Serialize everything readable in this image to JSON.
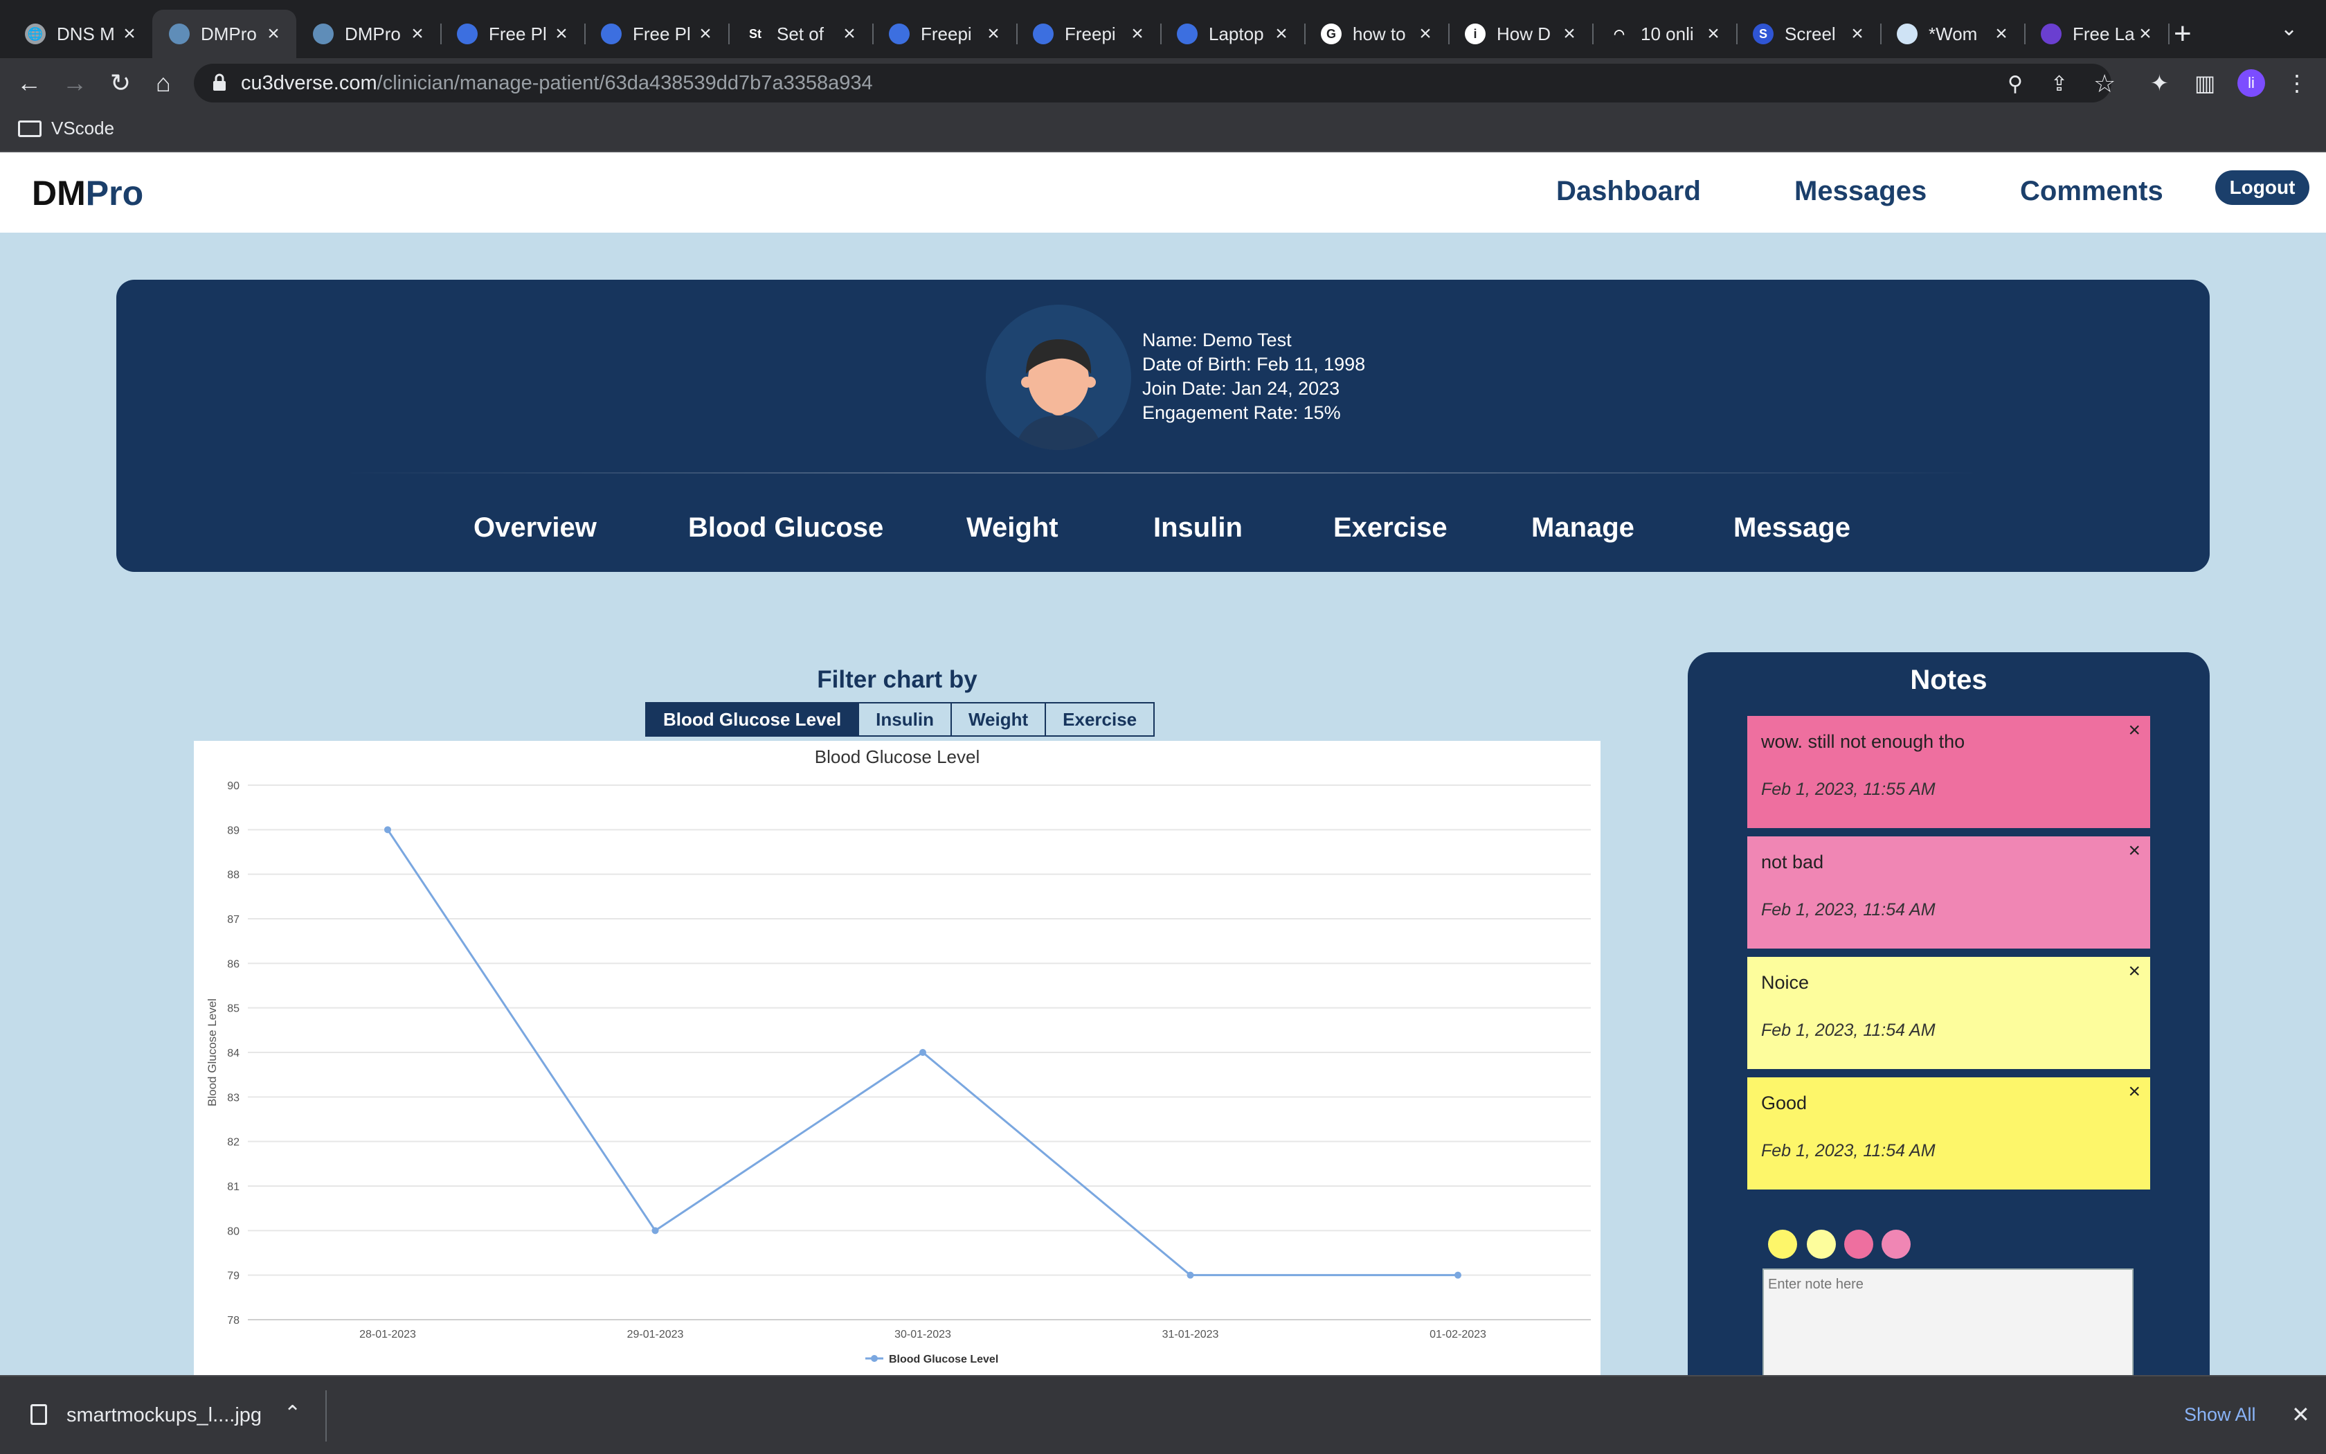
{
  "browser": {
    "tabs": [
      {
        "title": "DNS M",
        "favicon_color": "#9aa0a6",
        "favicon_glyph": "🌐",
        "active": false
      },
      {
        "title": "DMPro",
        "favicon_color": "#5f8db8",
        "favicon_glyph": "",
        "active": true
      },
      {
        "title": "DMPro",
        "favicon_color": "#5f8db8",
        "favicon_glyph": "",
        "active": false
      },
      {
        "title": "Free Pl",
        "favicon_color": "#3c6fe0",
        "favicon_glyph": "",
        "active": false
      },
      {
        "title": "Free Pl",
        "favicon_color": "#3c6fe0",
        "favicon_glyph": "",
        "active": false
      },
      {
        "title": "Set of",
        "favicon_color": "#202124",
        "favicon_glyph": "St",
        "active": false
      },
      {
        "title": "Freepi",
        "favicon_color": "#3c6fe0",
        "favicon_glyph": "",
        "active": false
      },
      {
        "title": "Freepi",
        "favicon_color": "#3c6fe0",
        "favicon_glyph": "",
        "active": false
      },
      {
        "title": "Laptop",
        "favicon_color": "#3c6fe0",
        "favicon_glyph": "",
        "active": false
      },
      {
        "title": "how to",
        "favicon_color": "#ffffff",
        "favicon_glyph": "G",
        "active": false
      },
      {
        "title": "How D",
        "favicon_color": "#ffffff",
        "favicon_glyph": "i",
        "active": false
      },
      {
        "title": "10 onli",
        "favicon_color": "#202124",
        "favicon_glyph": "◠",
        "active": false
      },
      {
        "title": "Screel",
        "favicon_color": "#2f55d4",
        "favicon_glyph": "S",
        "active": false
      },
      {
        "title": "*Wom",
        "favicon_color": "#cfe3f5",
        "favicon_glyph": "",
        "active": false
      },
      {
        "title": "Free La",
        "favicon_color": "#6a3fd0",
        "favicon_glyph": "",
        "active": false
      }
    ],
    "url_host": "cu3dverse.com",
    "url_path": "/clinician/manage-patient/63da438539dd7b7a3358a934",
    "bookmark_label": "VScode",
    "profile_initial": "li"
  },
  "header": {
    "logo_dm": "DM",
    "logo_pro": "Pro",
    "nav": [
      "Dashboard",
      "Messages",
      "Comments"
    ],
    "logout_label": "Logout"
  },
  "patient": {
    "name_line": "Name: Demo Test",
    "dob_line": "Date of Birth: Feb 11, 1998",
    "join_line": "Join Date: Jan 24, 2023",
    "engagement_line": "Engagement Rate: 15%"
  },
  "patient_tabs": [
    "Overview",
    "Blood Glucose",
    "Weight",
    "Insulin",
    "Exercise",
    "Manage",
    "Message"
  ],
  "filter": {
    "title": "Filter chart by",
    "options": [
      "Blood Glucose Level",
      "Insulin",
      "Weight",
      "Exercise"
    ],
    "active_index": 0
  },
  "chart_data": {
    "type": "line",
    "title": "Blood Glucose Level",
    "xlabel": "",
    "ylabel": "Blood Glucose Level",
    "x": [
      "28-01-2023",
      "29-01-2023",
      "30-01-2023",
      "31-01-2023",
      "01-02-2023"
    ],
    "series": [
      {
        "name": "Blood Glucose Level",
        "values": [
          89,
          80,
          84,
          79,
          79
        ],
        "color": "#7aa7e0"
      }
    ],
    "ylim": [
      78,
      90
    ],
    "yticks": [
      78,
      79,
      80,
      81,
      82,
      83,
      84,
      85,
      86,
      87,
      88,
      89,
      90
    ],
    "grid": true,
    "legend": "bottom"
  },
  "notes": {
    "title": "Notes",
    "items": [
      {
        "text": "wow. still not enough tho",
        "date": "Feb 1, 2023, 11:55 AM",
        "color": "#ee6f9f"
      },
      {
        "text": "not bad",
        "date": "Feb 1, 2023, 11:54 AM",
        "color": "#f086b4"
      },
      {
        "text": "Noice",
        "date": "Feb 1, 2023, 11:54 AM",
        "color": "#fdfd9c"
      },
      {
        "text": "Good",
        "date": "Feb 1, 2023, 11:54 AM",
        "color": "#fdf66a"
      }
    ],
    "color_options": [
      "#fdf66a",
      "#fdfd9c",
      "#ee6f9f",
      "#f086b4"
    ],
    "input_placeholder": "Enter note here",
    "close_icon": "×"
  },
  "downloads": {
    "file_name": "smartmockups_l....jpg",
    "show_all_label": "Show All"
  }
}
